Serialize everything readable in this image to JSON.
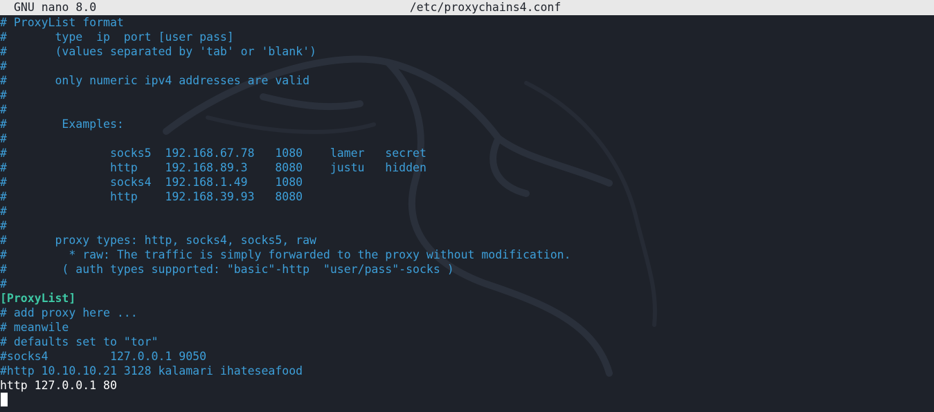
{
  "titlebar": {
    "app": "GNU nano 8.0",
    "filename": "/etc/proxychains4.conf"
  },
  "colors": {
    "comment": "#3d9fd9",
    "section": "#3ec7a4",
    "text": "#ffffff",
    "background": "#1e222a",
    "titlebar_bg": "#e8e8e8"
  },
  "lines": [
    {
      "text": "# ProxyList format",
      "kind": "comment"
    },
    {
      "text": "#       type  ip  port [user pass]",
      "kind": "comment"
    },
    {
      "text": "#       (values separated by 'tab' or 'blank')",
      "kind": "comment"
    },
    {
      "text": "#",
      "kind": "comment"
    },
    {
      "text": "#       only numeric ipv4 addresses are valid",
      "kind": "comment"
    },
    {
      "text": "#",
      "kind": "comment"
    },
    {
      "text": "#",
      "kind": "comment"
    },
    {
      "text": "#        Examples:",
      "kind": "comment"
    },
    {
      "text": "#",
      "kind": "comment"
    },
    {
      "text": "#               socks5  192.168.67.78   1080    lamer   secret",
      "kind": "comment"
    },
    {
      "text": "#               http    192.168.89.3    8080    justu   hidden",
      "kind": "comment"
    },
    {
      "text": "#               socks4  192.168.1.49    1080",
      "kind": "comment"
    },
    {
      "text": "#               http    192.168.39.93   8080",
      "kind": "comment"
    },
    {
      "text": "#",
      "kind": "comment"
    },
    {
      "text": "#",
      "kind": "comment"
    },
    {
      "text": "#       proxy types: http, socks4, socks5, raw",
      "kind": "comment"
    },
    {
      "text": "#         * raw: The traffic is simply forwarded to the proxy without modification.",
      "kind": "comment"
    },
    {
      "text": "#        ( auth types supported: \"basic\"-http  \"user/pass\"-socks )",
      "kind": "comment"
    },
    {
      "text": "#",
      "kind": "comment"
    },
    {
      "text": "[ProxyList]",
      "kind": "section"
    },
    {
      "text": "# add proxy here ...",
      "kind": "comment"
    },
    {
      "text": "# meanwile",
      "kind": "comment"
    },
    {
      "text": "# defaults set to \"tor\"",
      "kind": "comment"
    },
    {
      "text": "#socks4         127.0.0.1 9050",
      "kind": "comment"
    },
    {
      "text": "#http 10.10.10.21 3128 kalamari ihateseafood",
      "kind": "comment"
    },
    {
      "text": "http 127.0.0.1 80",
      "kind": "plain"
    },
    {
      "text": "",
      "kind": "plain"
    }
  ]
}
